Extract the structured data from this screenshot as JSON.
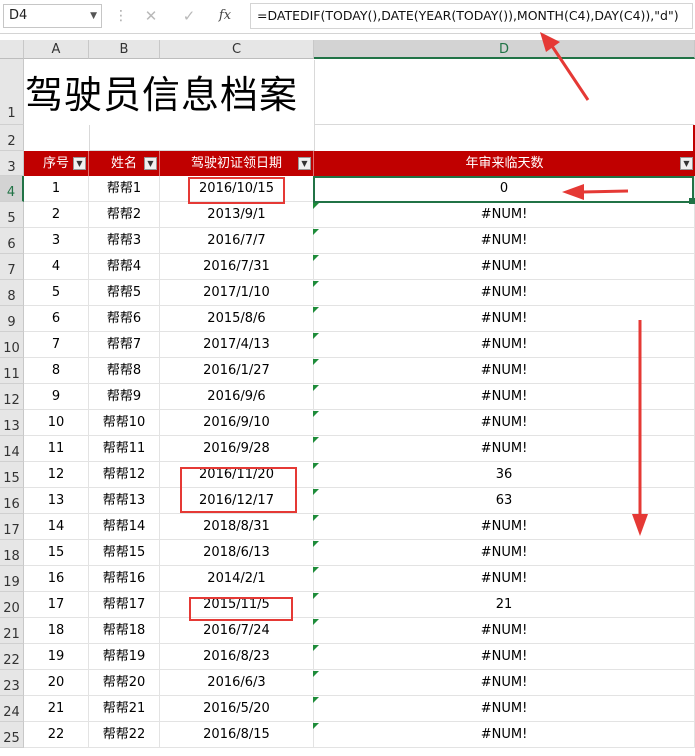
{
  "formula_bar": {
    "name_box": "D4",
    "cancel_icon": "✕",
    "enter_icon": "✓",
    "fx_label": "fx",
    "formula": "=DATEDIF(TODAY(),DATE(YEAR(TODAY()),MONTH(C4),DAY(C4)),\"d\")"
  },
  "columns": [
    "A",
    "B",
    "C",
    "D"
  ],
  "title": "驾驶员信息档案",
  "table_headers": [
    "序号",
    "姓名",
    "驾驶初证领日期",
    "年审来临天数"
  ],
  "rows": [
    {
      "row": "4",
      "no": "1",
      "name": "帮帮1",
      "date": "2016/10/15",
      "days": "0"
    },
    {
      "row": "5",
      "no": "2",
      "name": "帮帮2",
      "date": "2013/9/1",
      "days": "#NUM!"
    },
    {
      "row": "6",
      "no": "3",
      "name": "帮帮3",
      "date": "2016/7/7",
      "days": "#NUM!"
    },
    {
      "row": "7",
      "no": "4",
      "name": "帮帮4",
      "date": "2016/7/31",
      "days": "#NUM!"
    },
    {
      "row": "8",
      "no": "5",
      "name": "帮帮5",
      "date": "2017/1/10",
      "days": "#NUM!"
    },
    {
      "row": "9",
      "no": "6",
      "name": "帮帮6",
      "date": "2015/8/6",
      "days": "#NUM!"
    },
    {
      "row": "10",
      "no": "7",
      "name": "帮帮7",
      "date": "2017/4/13",
      "days": "#NUM!"
    },
    {
      "row": "11",
      "no": "8",
      "name": "帮帮8",
      "date": "2016/1/27",
      "days": "#NUM!"
    },
    {
      "row": "12",
      "no": "9",
      "name": "帮帮9",
      "date": "2016/9/6",
      "days": "#NUM!"
    },
    {
      "row": "13",
      "no": "10",
      "name": "帮帮10",
      "date": "2016/9/10",
      "days": "#NUM!"
    },
    {
      "row": "14",
      "no": "11",
      "name": "帮帮11",
      "date": "2016/9/28",
      "days": "#NUM!"
    },
    {
      "row": "15",
      "no": "12",
      "name": "帮帮12",
      "date": "2016/11/20",
      "days": "36"
    },
    {
      "row": "16",
      "no": "13",
      "name": "帮帮13",
      "date": "2016/12/17",
      "days": "63"
    },
    {
      "row": "17",
      "no": "14",
      "name": "帮帮14",
      "date": "2018/8/31",
      "days": "#NUM!"
    },
    {
      "row": "18",
      "no": "15",
      "name": "帮帮15",
      "date": "2018/6/13",
      "days": "#NUM!"
    },
    {
      "row": "19",
      "no": "16",
      "name": "帮帮16",
      "date": "2014/2/1",
      "days": "#NUM!"
    },
    {
      "row": "20",
      "no": "17",
      "name": "帮帮17",
      "date": "2015/11/5",
      "days": "21"
    },
    {
      "row": "21",
      "no": "18",
      "name": "帮帮18",
      "date": "2016/7/24",
      "days": "#NUM!"
    },
    {
      "row": "22",
      "no": "19",
      "name": "帮帮19",
      "date": "2016/8/23",
      "days": "#NUM!"
    },
    {
      "row": "23",
      "no": "20",
      "name": "帮帮20",
      "date": "2016/6/3",
      "days": "#NUM!"
    },
    {
      "row": "24",
      "no": "21",
      "name": "帮帮21",
      "date": "2016/5/20",
      "days": "#NUM!"
    },
    {
      "row": "25",
      "no": "22",
      "name": "帮帮22",
      "date": "2016/8/15",
      "days": "#NUM!"
    }
  ],
  "top_rows": [
    "1",
    "2",
    "3"
  ],
  "colors": {
    "header_red": "#c00000",
    "excel_green": "#217346",
    "annotation_red": "#e53935"
  }
}
